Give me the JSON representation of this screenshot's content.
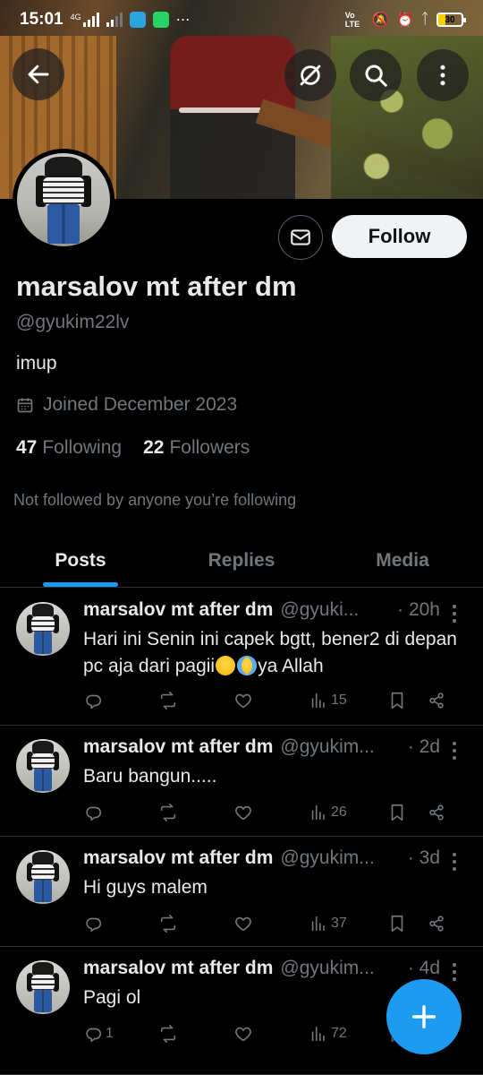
{
  "statusbar": {
    "time": "15:01",
    "network": "4G",
    "volte": "Vo LTE",
    "battery": "30",
    "battery_level": 0.3
  },
  "profile": {
    "name": "marsalov mt after dm",
    "handle": "@gyukim22lv",
    "bio": "imup",
    "joined": "Joined December 2023",
    "following_count": "47",
    "following_label": "Following",
    "followers_count": "22",
    "followers_label": "Followers",
    "not_followed": "Not followed by anyone you’re following",
    "follow_label": "Follow"
  },
  "tabs": [
    {
      "label": "Posts",
      "active": true
    },
    {
      "label": "Replies",
      "active": false
    },
    {
      "label": "Media",
      "active": false
    }
  ],
  "posts": [
    {
      "name": "marsalov mt after dm",
      "handle": "@gyuki...",
      "time": "· 20h",
      "text": "Hari ini Senin ini capek bgtt, bener2 di depan pc aja dari pagii",
      "emoji": [
        "smiling-face-with-tear-emoji",
        "loudly-crying-face-emoji"
      ],
      "text_tail": "ya Allah",
      "replies": "",
      "views": "15"
    },
    {
      "name": "marsalov mt after dm",
      "handle": "@gyukim...",
      "time": "· 2d",
      "text": "Baru bangun.....",
      "replies": "",
      "views": "26"
    },
    {
      "name": "marsalov mt after dm",
      "handle": "@gyukim...",
      "time": "· 3d",
      "text": "Hi guys malem",
      "replies": "",
      "views": "37"
    },
    {
      "name": "marsalov mt after dm",
      "handle": "@gyukim...",
      "time": "· 4d",
      "text": "Pagi ol",
      "replies": "1",
      "views": "72"
    }
  ],
  "icons": {
    "back": "arrow-left-icon",
    "translate": "no-translate-icon",
    "search": "search-icon",
    "more": "more-vertical-icon",
    "message": "envelope-icon",
    "calendar": "calendar-icon",
    "reply": "reply-icon",
    "repost": "repost-icon",
    "like": "heart-icon",
    "views": "views-icon",
    "bookmark": "bookmark-icon",
    "share": "share-icon",
    "compose": "plus-icon"
  },
  "colors": {
    "accent": "#1d9bf0",
    "background": "#000000",
    "muted": "#71767b",
    "text": "#e7e9ea"
  }
}
